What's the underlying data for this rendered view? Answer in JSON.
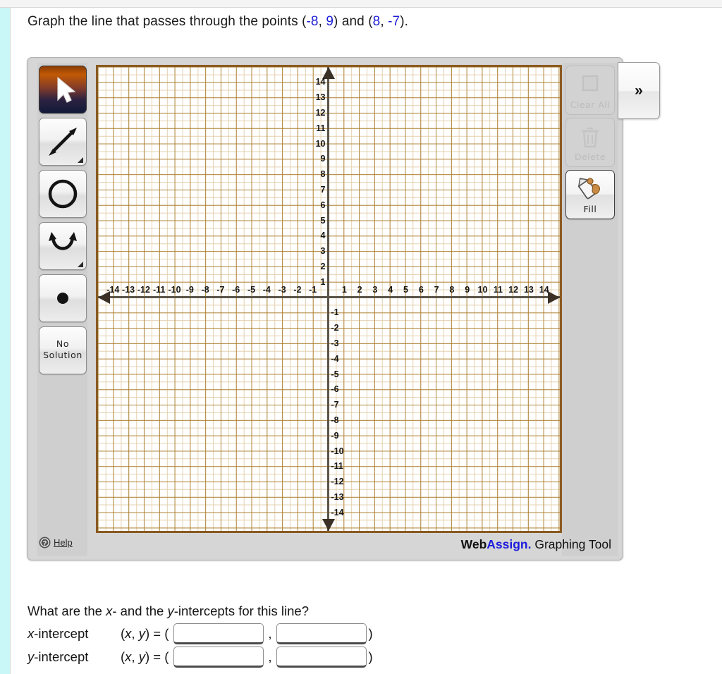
{
  "prompt": {
    "part1": "Graph the line that passes through the points (",
    "p1x": "-8",
    "sep1": ", ",
    "p1y": "9",
    "mid": ") and (",
    "p2x": "8",
    "sep2": ", ",
    "p2y": "-7",
    "end": ")."
  },
  "left_toolbar": {
    "tools": [
      {
        "name": "select-tool",
        "icon": "cursor-arrow-icon",
        "label": "",
        "active": true
      },
      {
        "name": "line-tool",
        "icon": "double-arrow-line-icon",
        "label": "",
        "active": false
      },
      {
        "name": "circle-tool",
        "icon": "circle-icon",
        "label": "",
        "active": false
      },
      {
        "name": "parabola-tool",
        "icon": "parabola-icon",
        "label": "",
        "active": false
      },
      {
        "name": "point-tool",
        "icon": "filled-dot-icon",
        "label": "",
        "active": false
      },
      {
        "name": "no-solution-tool",
        "icon": "",
        "label": "No Solution",
        "active": false
      }
    ],
    "help_label": "Help",
    "help_icon": "question-mark-circle-icon"
  },
  "right_toolbar": {
    "buttons": [
      {
        "name": "clear-all-button",
        "label": "Clear All",
        "icon": "square-outline-icon",
        "enabled": false
      },
      {
        "name": "delete-button",
        "label": "Delete",
        "icon": "trash-can-icon",
        "enabled": false
      },
      {
        "name": "fill-button",
        "label": "Fill",
        "icon": "paint-bucket-icon",
        "enabled": true
      }
    ],
    "expand_label": "»"
  },
  "branding": {
    "web": "Web",
    "assign": "Assign.",
    "tool": " Graphing Tool",
    "accent_color": "#1c1cdd"
  },
  "chart_data": {
    "type": "scatter",
    "title": "",
    "xlabel": "",
    "ylabel": "",
    "xlim": [
      -15,
      15
    ],
    "ylim": [
      -15,
      15
    ],
    "grid": true,
    "major_step": 1,
    "minor_step": 0.5,
    "grid_major_color": "#a87a28",
    "grid_minor_color": "#e2ceaa",
    "axis_color": "#5b5448",
    "x_ticks": [
      -14,
      -13,
      -12,
      -11,
      -10,
      -9,
      -8,
      -7,
      -6,
      -5,
      -4,
      -3,
      -2,
      -1,
      1,
      2,
      3,
      4,
      5,
      6,
      7,
      8,
      9,
      10,
      11,
      12,
      13,
      14
    ],
    "y_ticks": [
      14,
      13,
      12,
      11,
      10,
      9,
      8,
      7,
      6,
      5,
      4,
      3,
      2,
      1,
      -1,
      -2,
      -3,
      -4,
      -5,
      -6,
      -7,
      -8,
      -9,
      -10,
      -11,
      -12,
      -13,
      -14
    ],
    "series": [],
    "drawn_objects": []
  },
  "bottom": {
    "question": "What are the x- and the y-intercepts for this line?",
    "rows": [
      {
        "name": "x-intercept-row",
        "label": "x-intercept",
        "eq": "(x, y) = (",
        "x_value": "",
        "y_value": "",
        "comma": ",",
        "close": ")"
      },
      {
        "name": "y-intercept-row",
        "label": "y-intercept",
        "eq": "(x, y) = (",
        "x_value": "",
        "y_value": "",
        "comma": ",",
        "close": ")"
      }
    ]
  }
}
